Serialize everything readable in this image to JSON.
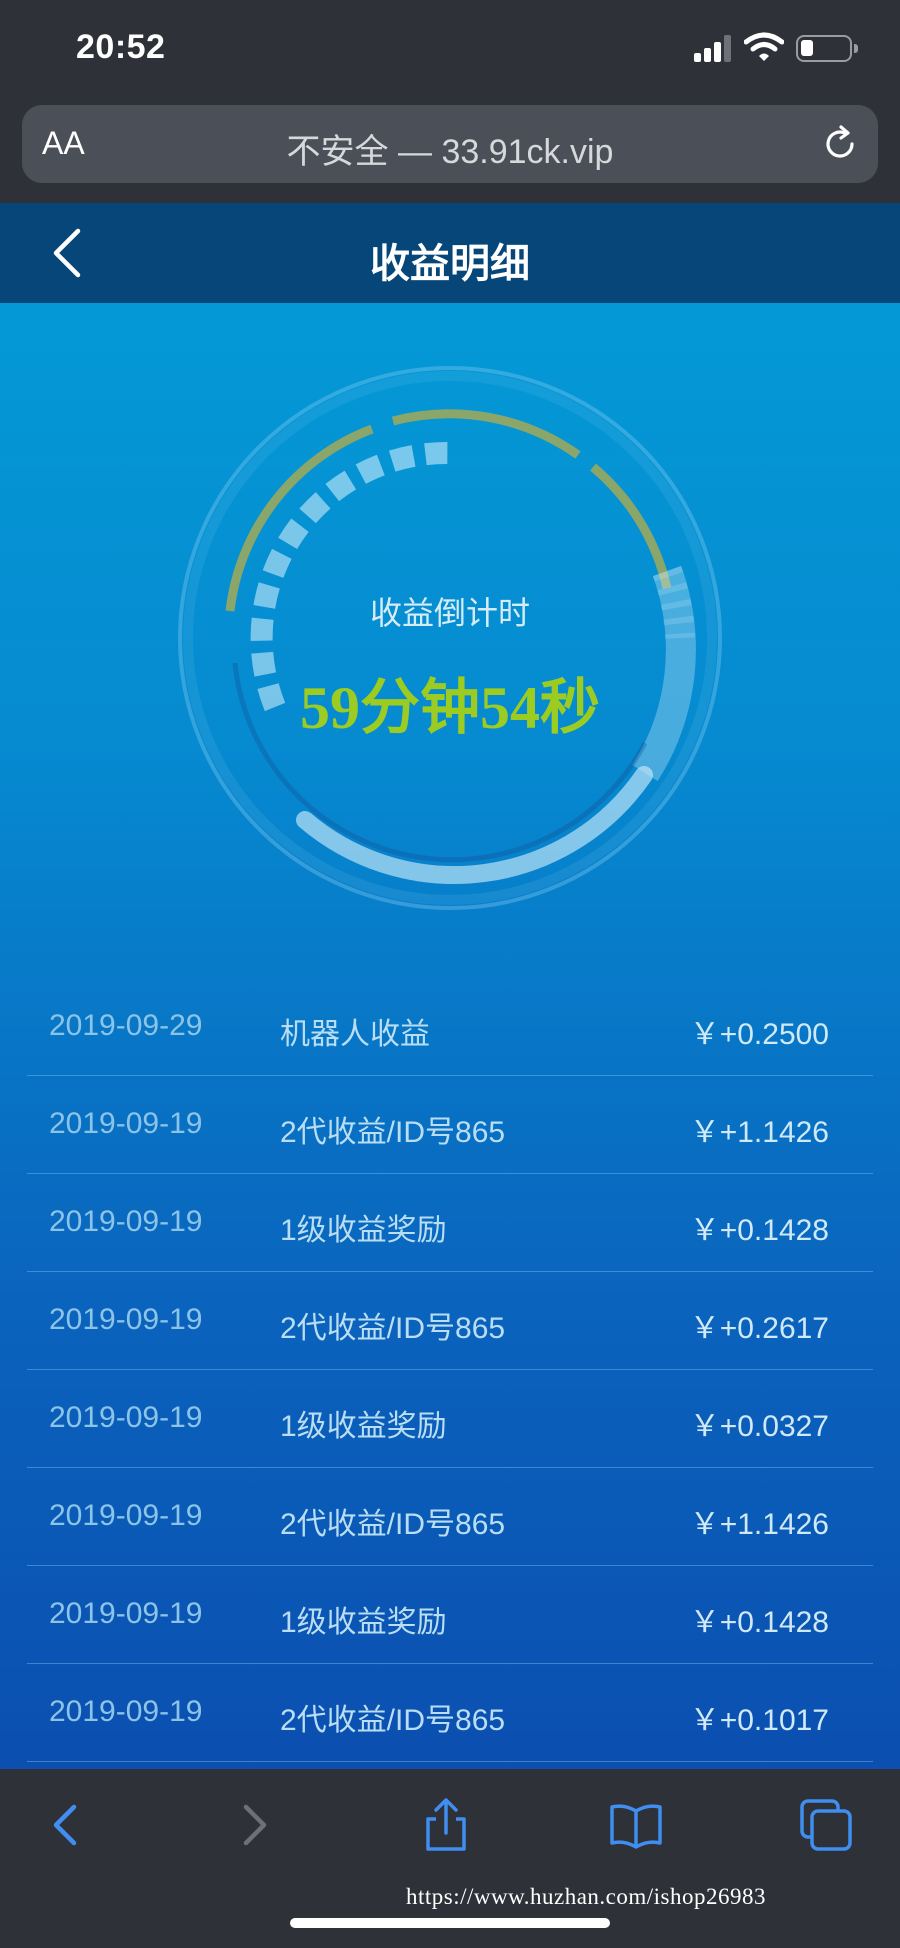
{
  "status_bar": {
    "time": "20:52",
    "icons": [
      "cellular-signal-icon",
      "wifi-icon",
      "battery-icon"
    ]
  },
  "browser": {
    "text_size_label": "AA",
    "url": "不安全 — 33.91ck.vip",
    "reload_icon": "reload-icon"
  },
  "header": {
    "title": "收益明细",
    "back_icon": "chevron-left-icon"
  },
  "gauge": {
    "label": "收益倒计时",
    "countdown": "59分钟54秒"
  },
  "records": [
    {
      "date": "2019-09-29",
      "desc": "机器人收益",
      "amount": "￥+0.2500"
    },
    {
      "date": "2019-09-19",
      "desc": "2代收益/ID号865",
      "amount": "￥+1.1426"
    },
    {
      "date": "2019-09-19",
      "desc": "1级收益奖励",
      "amount": "￥+0.1428"
    },
    {
      "date": "2019-09-19",
      "desc": "2代收益/ID号865",
      "amount": "￥+0.2617"
    },
    {
      "date": "2019-09-19",
      "desc": "1级收益奖励",
      "amount": "￥+0.0327"
    },
    {
      "date": "2019-09-19",
      "desc": "2代收益/ID号865",
      "amount": "￥+1.1426"
    },
    {
      "date": "2019-09-19",
      "desc": "1级收益奖励",
      "amount": "￥+0.1428"
    },
    {
      "date": "2019-09-19",
      "desc": "2代收益/ID号865",
      "amount": "￥+0.1017"
    }
  ],
  "toolbar": {
    "icons": [
      "back-arrow-icon",
      "forward-arrow-icon",
      "share-icon",
      "bookmarks-icon",
      "tabs-icon"
    ],
    "accent_color": "#3f8ef0",
    "disabled_color": "#6d7078"
  },
  "watermark": "https://www.huzhan.com/ishop26983"
}
